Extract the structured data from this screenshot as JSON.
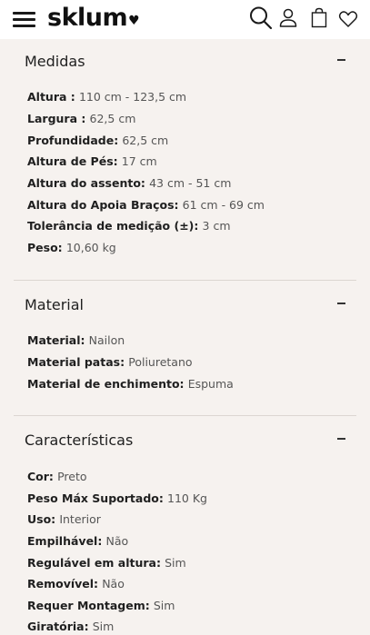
{
  "header": {
    "brand": "sklum",
    "brand_heart": "♥",
    "icons": [
      "hamburger-menu-icon",
      "search-icon",
      "user-icon",
      "shopping-bag-icon",
      "heart-icon"
    ]
  },
  "sections": [
    {
      "title": "Medidas",
      "toggle": "−",
      "items": [
        {
          "label": "Altura :",
          "value": "110 cm - 123,5 cm"
        },
        {
          "label": "Largura :",
          "value": "62,5 cm"
        },
        {
          "label": "Profundidade:",
          "value": "62,5 cm"
        },
        {
          "label": "Altura de Pés:",
          "value": "17 cm"
        },
        {
          "label": "Altura do assento:",
          "value": "43 cm - 51 cm"
        },
        {
          "label": "Altura do Apoia Braços:",
          "value": "61 cm - 69 cm"
        },
        {
          "label": "Tolerância de medição (±):",
          "value": "3 cm"
        },
        {
          "label": "Peso:",
          "value": "10,60 kg"
        }
      ]
    },
    {
      "title": "Material",
      "toggle": "−",
      "items": [
        {
          "label": "Material:",
          "value": "Nailon"
        },
        {
          "label": "Material patas:",
          "value": "Poliuretano"
        },
        {
          "label": "Material de enchimento:",
          "value": "Espuma"
        }
      ]
    },
    {
      "title": "Características",
      "toggle": "−",
      "items": [
        {
          "label": "Cor:",
          "value": "Preto"
        },
        {
          "label": "Peso Máx Suportado:",
          "value": "110 Kg"
        },
        {
          "label": "Uso:",
          "value": "Interior"
        },
        {
          "label": "Empilhável:",
          "value": "Não"
        },
        {
          "label": "Regulável em altura:",
          "value": "Sim"
        },
        {
          "label": "Removível:",
          "value": "Não"
        },
        {
          "label": "Requer Montagem:",
          "value": "Sim"
        },
        {
          "label": "Giratória:",
          "value": "Sim"
        }
      ]
    }
  ]
}
